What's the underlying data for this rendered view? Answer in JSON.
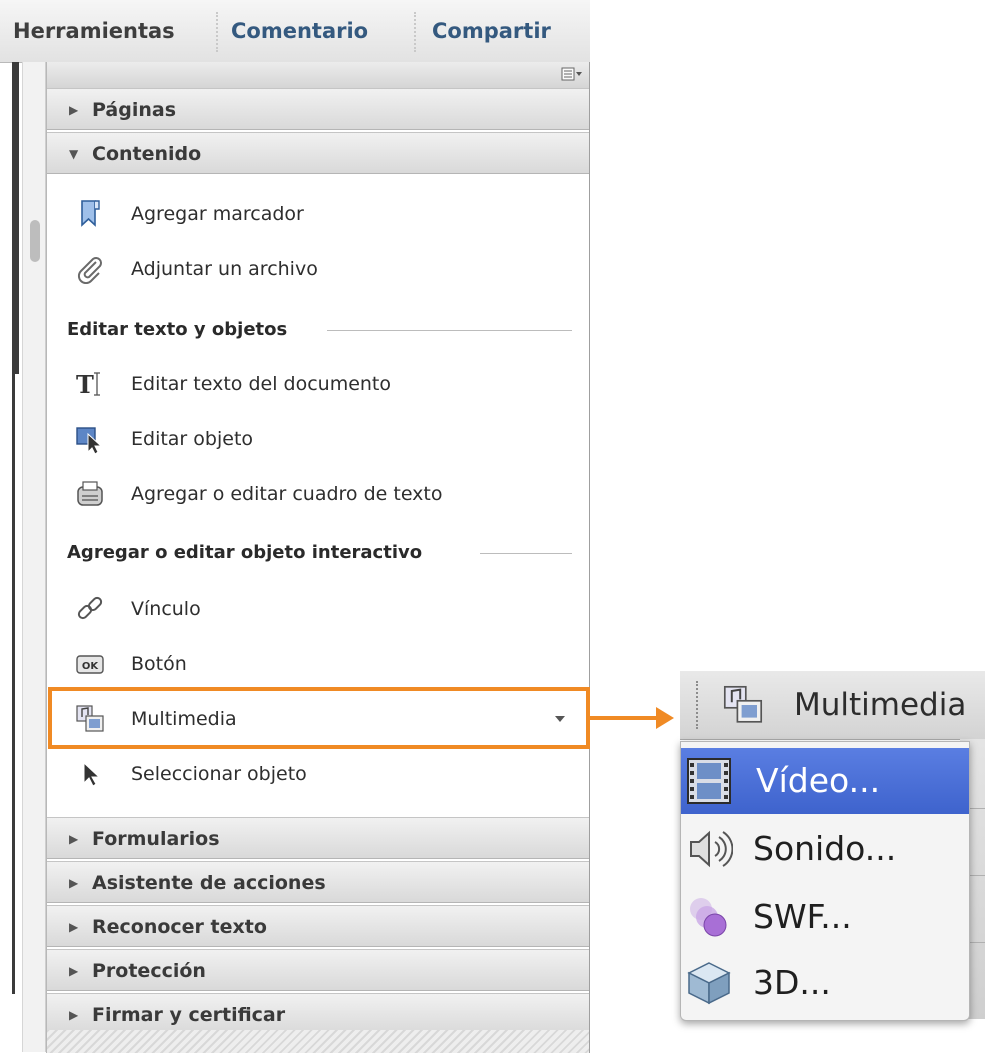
{
  "tabs": [
    "Herramientas",
    "Comentario",
    "Compartir"
  ],
  "sections_top": [
    {
      "label": "Páginas",
      "expanded": false
    },
    {
      "label": "Contenido",
      "expanded": true
    }
  ],
  "content_items": [
    {
      "label": "Agregar marcador",
      "icon": "bookmark-icon"
    },
    {
      "label": "Adjuntar un archivo",
      "icon": "paperclip-icon"
    }
  ],
  "edit_group": {
    "title": "Editar texto y objetos",
    "items": [
      {
        "label": "Editar texto del documento",
        "icon": "text-edit-icon"
      },
      {
        "label": "Editar objeto",
        "icon": "edit-object-icon"
      },
      {
        "label": "Agregar o editar cuadro de texto",
        "icon": "typewriter-icon"
      }
    ]
  },
  "interactive_group": {
    "title": "Agregar o editar objeto interactivo",
    "items": [
      {
        "label": "Vínculo",
        "icon": "link-icon"
      },
      {
        "label": "Botón",
        "icon": "ok-button-icon"
      },
      {
        "label": "Multimedia",
        "icon": "multimedia-icon",
        "has_dropdown": true
      },
      {
        "label": "Seleccionar objeto",
        "icon": "arrow-cursor-icon"
      }
    ]
  },
  "sections_bottom": [
    {
      "label": "Formularios"
    },
    {
      "label": "Asistente de acciones"
    },
    {
      "label": "Reconocer texto"
    },
    {
      "label": "Protección"
    },
    {
      "label": "Firmar y certificar"
    }
  ],
  "popup": {
    "button_label": "Multimedia",
    "menu": [
      {
        "label": "Vídeo...",
        "icon": "film-icon",
        "selected": true
      },
      {
        "label": "Sonido...",
        "icon": "speaker-icon",
        "selected": false
      },
      {
        "label": "SWF...",
        "icon": "swf-icon",
        "selected": false
      },
      {
        "label": "3D...",
        "icon": "cube-3d-icon",
        "selected": false
      }
    ]
  },
  "colors": {
    "highlight": "#f08a24",
    "tab_active_text": "#3e3e3e",
    "tab_text": "#34597f",
    "menu_selected": "#4a6fd8"
  }
}
